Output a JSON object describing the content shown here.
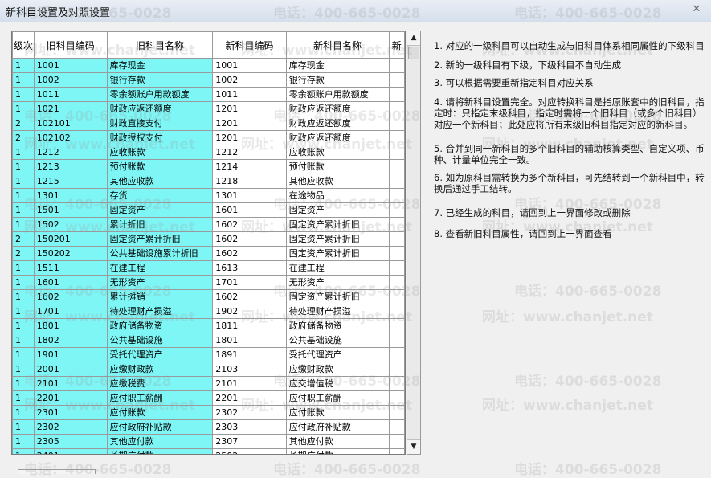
{
  "window": {
    "title": "新科目设置及对照设置"
  },
  "table": {
    "headers": {
      "level": "级次",
      "old_code": "旧科目编码",
      "old_name": "旧科目名称",
      "new_code": "新科目编码",
      "new_name": "新科目名称",
      "extra": "新"
    },
    "rows": [
      [
        "1",
        "1001",
        "库存现金",
        "1001",
        "库存现金"
      ],
      [
        "1",
        "1002",
        "银行存款",
        "1002",
        "银行存款"
      ],
      [
        "1",
        "1011",
        "零余额账户用款额度",
        "1011",
        "零余额账户用款额度"
      ],
      [
        "1",
        "1021",
        "财政应返还额度",
        "1201",
        "财政应返还额度"
      ],
      [
        "2",
        "102101",
        "财政直接支付",
        "1201",
        "财政应返还额度"
      ],
      [
        "2",
        "102102",
        "财政授权支付",
        "1201",
        "财政应返还额度"
      ],
      [
        "1",
        "1212",
        "应收账款",
        "1212",
        "应收账款"
      ],
      [
        "1",
        "1213",
        "预付账款",
        "1214",
        "预付账款"
      ],
      [
        "1",
        "1215",
        "其他应收款",
        "1218",
        "其他应收款"
      ],
      [
        "1",
        "1301",
        "存货",
        "1301",
        "在途物品"
      ],
      [
        "1",
        "1501",
        "固定资产",
        "1601",
        "固定资产"
      ],
      [
        "1",
        "1502",
        "累计折旧",
        "1602",
        "固定资产累计折旧"
      ],
      [
        "2",
        "150201",
        "固定资产累计折旧",
        "1602",
        "固定资产累计折旧"
      ],
      [
        "2",
        "150202",
        "公共基础设施累计折旧",
        "1602",
        "固定资产累计折旧"
      ],
      [
        "1",
        "1511",
        "在建工程",
        "1613",
        "在建工程"
      ],
      [
        "1",
        "1601",
        "无形资产",
        "1701",
        "无形资产"
      ],
      [
        "1",
        "1602",
        "累计摊销",
        "1602",
        "固定资产累计折旧"
      ],
      [
        "1",
        "1701",
        "待处理财产损溢",
        "1902",
        "待处理财产损溢"
      ],
      [
        "1",
        "1801",
        "政府储备物资",
        "1811",
        "政府储备物资"
      ],
      [
        "1",
        "1802",
        "公共基础设施",
        "1801",
        "公共基础设施"
      ],
      [
        "1",
        "1901",
        "受托代理资产",
        "1891",
        "受托代理资产"
      ],
      [
        "1",
        "2001",
        "应缴财政款",
        "2103",
        "应缴财政款"
      ],
      [
        "1",
        "2101",
        "应缴税费",
        "2101",
        "应交增值税"
      ],
      [
        "1",
        "2201",
        "应付职工薪酬",
        "2201",
        "应付职工薪酬"
      ],
      [
        "1",
        "2301",
        "应付账款",
        "2302",
        "应付账款"
      ],
      [
        "1",
        "2302",
        "应付政府补贴款",
        "2303",
        "应付政府补贴款"
      ],
      [
        "1",
        "2305",
        "其他应付款",
        "2307",
        "其他应付款"
      ],
      [
        "1",
        "2401",
        "长期应付款",
        "2502",
        "长期应付款"
      ]
    ]
  },
  "notes": [
    "1. 对应的一级科目可以自动生成与旧科目体系相同属性的下级科目",
    "2. 新的一级科目有下级，下级科目不自动生成",
    "3. 可以根据需要重新指定科目对应关系",
    "4. 请将新科目设置完全。对应转换科目是指原账套中的旧科目，指定时：只指定末级科目，指定时需将一个旧科目（或多个旧科目）对应一个新科目；此处应将所有末级旧科目指定对应的新科目。",
    "5. 合并到同一新科目的多个旧科目的辅助核算类型、自定义项、币种、计量单位完全一致。",
    "6. 如为原科目需转换为多个新科目，可先结转到一个新科目中，转换后通过手工结转。",
    "7. 已经生成的科目，请回到上一界面修改或删除",
    "8. 查看新旧科目属性，请回到上一界面查看"
  ],
  "watermark": {
    "phone": "电话：400-665-0028",
    "site": "网址：www.chanjet.net"
  }
}
